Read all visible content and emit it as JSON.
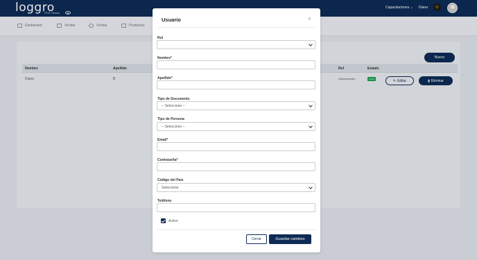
{
  "app": {
    "logo": "loggro",
    "logo_sub": "POS Tienda",
    "top_nav": {
      "menu_label": "Capacitaciones",
      "user_name": "Diana",
      "badge": "O"
    }
  },
  "nav": [
    "Dashboard",
    "Vender",
    "Ventas",
    "Productos"
  ],
  "list": {
    "new_button": "Nuevo",
    "columns": [
      "Nombre",
      "Apellido",
      "Rol",
      "Estado"
    ],
    "row": {
      "nombre": "Diana",
      "apellido": "B",
      "rol": "Administrador",
      "estado": "Activo"
    },
    "edit_button": "Editar",
    "delete_button": "Eliminar"
  },
  "modal": {
    "title": "Usuario",
    "close": "×",
    "fields": [
      {
        "label": "Rol",
        "type": "select",
        "value": ""
      },
      {
        "label": "Nombre*",
        "type": "text",
        "value": ""
      },
      {
        "label": "Apellido*",
        "type": "text",
        "value": ""
      },
      {
        "label": "Tipo de Documento",
        "type": "select",
        "value": "-- Seleccione --"
      },
      {
        "label": "Tipo de Persona",
        "type": "select",
        "value": "-- Seleccione --"
      },
      {
        "label": "Email*",
        "type": "text",
        "value": ""
      },
      {
        "label": "Contraseña*",
        "type": "password",
        "value": ""
      },
      {
        "label": "Código del País",
        "type": "select",
        "value": "Seleccione"
      },
      {
        "label": "Teléfono",
        "type": "text",
        "value": ""
      }
    ],
    "activo_label": "Activo",
    "activo_checked": true,
    "cancel_button": "Cerrar",
    "save_button": "Guardar cambios"
  },
  "colors": {
    "primary": "#0e2b55",
    "success": "#1f9d55"
  }
}
